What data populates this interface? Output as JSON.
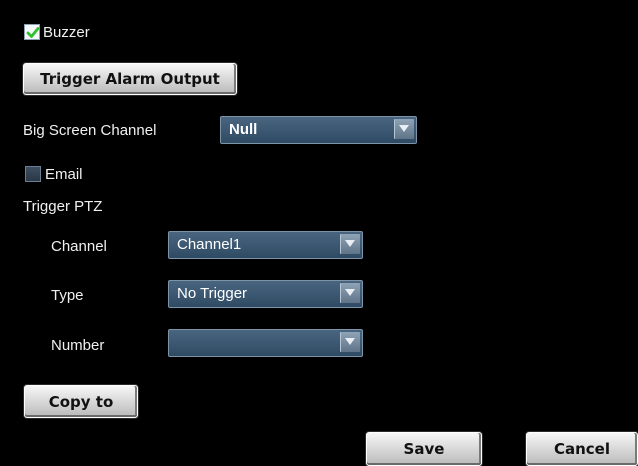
{
  "buzzer": {
    "label": "Buzzer",
    "checked": true
  },
  "trigger_alarm_output": {
    "label": "Trigger Alarm Output"
  },
  "big_screen_channel": {
    "label": "Big Screen Channel",
    "value": "Null"
  },
  "email": {
    "label": "Email",
    "checked": false
  },
  "trigger_ptz": {
    "heading": "Trigger PTZ",
    "channel": {
      "label": "Channel",
      "value": "Channel1"
    },
    "type": {
      "label": "Type",
      "value": "No Trigger"
    },
    "number": {
      "label": "Number",
      "value": ""
    }
  },
  "copy_to": {
    "label": "Copy to"
  },
  "footer": {
    "save_label": "Save",
    "cancel_label": "Cancel"
  },
  "icons": {
    "check": "checkmark-icon",
    "dropdown": "chevron-down-icon"
  },
  "colors": {
    "background": "#000000",
    "check_green": "#2fbf2f",
    "select_fill": "#34506a"
  }
}
